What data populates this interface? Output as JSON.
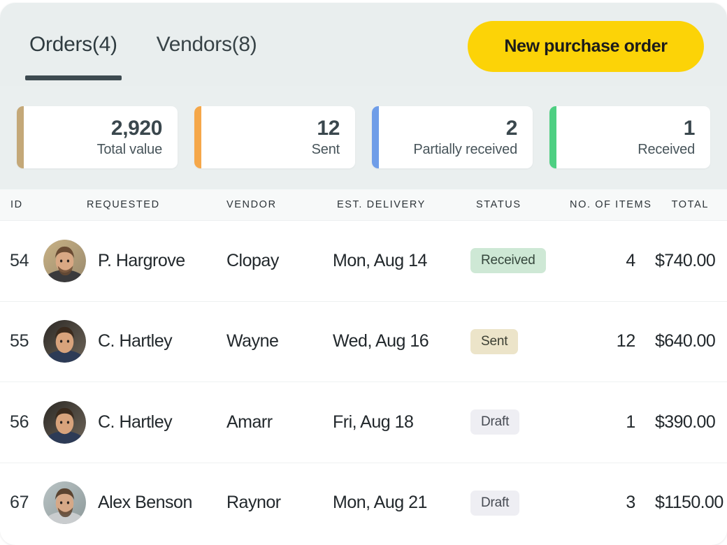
{
  "colors": {
    "brand_yellow": "#fcd307",
    "header_bg": "#e9eeee",
    "stats_bg": "#eaefef",
    "text_dark": "#22282c",
    "accent_total_value": "#c4a878",
    "accent_sent": "#f5a749",
    "accent_partially_received": "#6f9de8",
    "accent_received": "#4ecf82",
    "badge_received_bg": "#cee8d5",
    "badge_received_fg": "#35463c",
    "badge_sent_bg": "#ece4c9",
    "badge_sent_fg": "#3c3f33",
    "badge_draft_bg": "#eeeef3",
    "badge_draft_fg": "#464a52"
  },
  "header": {
    "tabs": [
      {
        "label": "Orders(4)",
        "active": true,
        "name": "tab-orders"
      },
      {
        "label": "Vendors(8)",
        "active": false,
        "name": "tab-vendors"
      }
    ],
    "cta_label": "New purchase order"
  },
  "stats": [
    {
      "value": "2,920",
      "label": "Total value",
      "color": "#c4a878"
    },
    {
      "value": "12",
      "label": "Sent",
      "color": "#f5a749"
    },
    {
      "value": "2",
      "label": "Partially received",
      "color": "#6f9de8"
    },
    {
      "value": "1",
      "label": "Received",
      "color": "#4ecf82"
    }
  ],
  "table": {
    "columns": [
      {
        "key": "id",
        "label": "ID"
      },
      {
        "key": "requested",
        "label": "REQUESTED"
      },
      {
        "key": "vendor",
        "label": "VENDOR"
      },
      {
        "key": "delivery",
        "label": "EST. DELIVERY"
      },
      {
        "key": "status",
        "label": "STATUS"
      },
      {
        "key": "items",
        "label": "NO. OF ITEMS"
      },
      {
        "key": "total",
        "label": "TOTAL"
      }
    ],
    "rows": [
      {
        "id": "54",
        "requested": "P. Hargrove",
        "avatar": "avatar-p-hargrove",
        "vendor": "Clopay",
        "delivery": "Mon, Aug 14",
        "status": "Received",
        "status_kind": "received",
        "items": "4",
        "total": "$740.00"
      },
      {
        "id": "55",
        "requested": "C. Hartley",
        "avatar": "avatar-c-hartley",
        "vendor": "Wayne",
        "delivery": "Wed, Aug 16",
        "status": "Sent",
        "status_kind": "sent",
        "items": "12",
        "total": "$640.00"
      },
      {
        "id": "56",
        "requested": "C. Hartley",
        "avatar": "avatar-c-hartley",
        "vendor": "Amarr",
        "delivery": "Fri, Aug 18",
        "status": "Draft",
        "status_kind": "draft",
        "items": "1",
        "total": "$390.00"
      },
      {
        "id": "67",
        "requested": "Alex Benson",
        "avatar": "avatar-alex-benson",
        "vendor": "Raynor",
        "delivery": "Mon, Aug 21",
        "status": "Draft",
        "status_kind": "draft",
        "items": "3",
        "total": "$1150.00"
      }
    ]
  }
}
